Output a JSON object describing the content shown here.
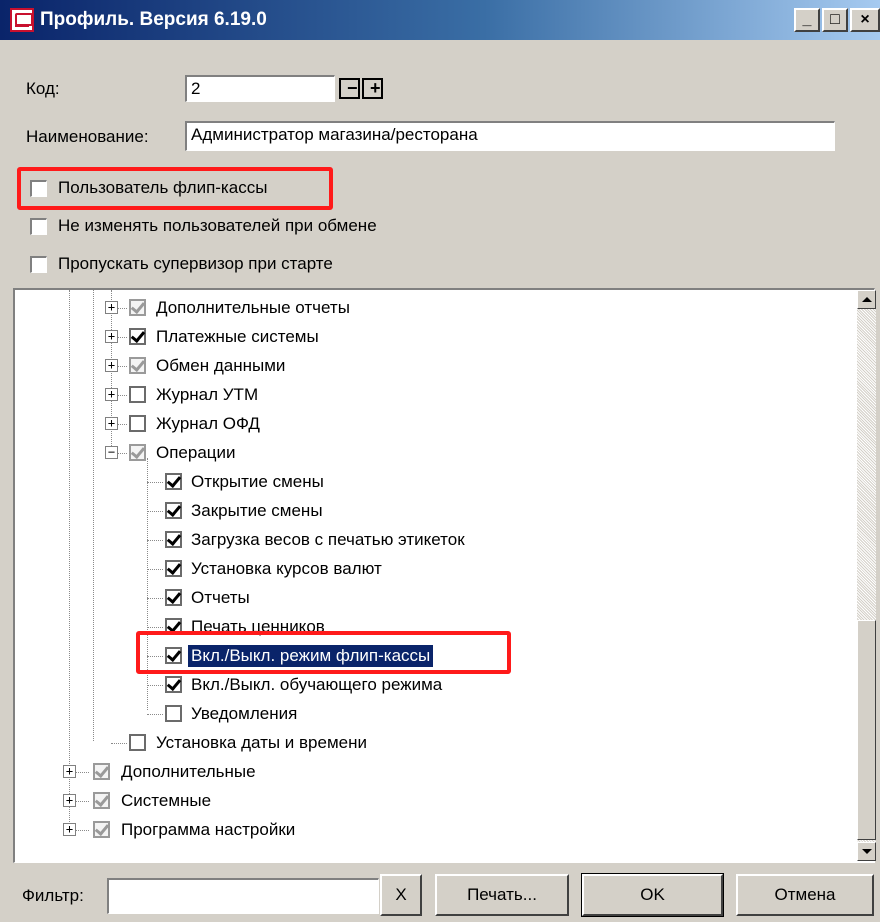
{
  "window": {
    "title": "Профиль. Версия 6.19.0",
    "caption_buttons": {
      "minimize": "_",
      "maximize": "□",
      "close": "×"
    }
  },
  "form": {
    "code_label": "Код:",
    "code_value": "2",
    "code_decrement": "−",
    "code_increment": "+",
    "name_label": "Наименование:",
    "name_value": "Администратор магазина/ресторана"
  },
  "options": [
    {
      "label": "Пользователь флип-кассы",
      "checked": false
    },
    {
      "label": "Не изменять пользователей при обмене",
      "checked": false
    },
    {
      "label": "Пропускать супервизор при старте",
      "checked": false
    }
  ],
  "tree": {
    "items": [
      {
        "label": "Дополнительные отчеты",
        "level": 2,
        "expander": "+",
        "state": "gray"
      },
      {
        "label": "Платежные системы",
        "level": 2,
        "expander": "+",
        "state": "checked"
      },
      {
        "label": "Обмен данными",
        "level": 2,
        "expander": "+",
        "state": "gray"
      },
      {
        "label": "Журнал УТМ",
        "level": 2,
        "expander": "+",
        "state": "unchecked"
      },
      {
        "label": "Журнал ОФД",
        "level": 2,
        "expander": "+",
        "state": "unchecked"
      },
      {
        "label": "Операции",
        "level": 2,
        "expander": "−",
        "state": "gray"
      },
      {
        "label": "Открытие смены",
        "level": 3,
        "expander": "",
        "state": "checked"
      },
      {
        "label": "Закрытие смены",
        "level": 3,
        "expander": "",
        "state": "checked"
      },
      {
        "label": "Загрузка весов с печатью этикеток",
        "level": 3,
        "expander": "",
        "state": "checked"
      },
      {
        "label": "Установка курсов валют",
        "level": 3,
        "expander": "",
        "state": "checked"
      },
      {
        "label": "Отчеты",
        "level": 3,
        "expander": "",
        "state": "checked"
      },
      {
        "label": "Печать ценников",
        "level": 3,
        "expander": "",
        "state": "checked"
      },
      {
        "label": "Вкл./Выкл. режим флип-кассы",
        "level": 3,
        "expander": "",
        "state": "checked",
        "selected": true
      },
      {
        "label": "Вкл./Выкл. обучающего режима",
        "level": 3,
        "expander": "",
        "state": "checked"
      },
      {
        "label": "Уведомления",
        "level": 3,
        "expander": "",
        "state": "unchecked"
      },
      {
        "label": "Установка даты и времени",
        "level": 2,
        "expander": "",
        "state": "unchecked"
      },
      {
        "label": "Дополнительные",
        "level": 1,
        "expander": "+",
        "state": "gray"
      },
      {
        "label": "Системные",
        "level": 1,
        "expander": "+",
        "state": "gray"
      },
      {
        "label": "Программа настройки",
        "level": 1,
        "expander": "+",
        "state": "gray"
      }
    ]
  },
  "footer": {
    "filter_label": "Фильтр:",
    "filter_value": "",
    "clear_label": "X",
    "print_label": "Печать...",
    "ok_label": "OK",
    "cancel_label": "Отмена"
  },
  "colors": {
    "highlight_box": "#ff1a1a",
    "selection": "#0a246a",
    "face": "#d4d0c8"
  }
}
